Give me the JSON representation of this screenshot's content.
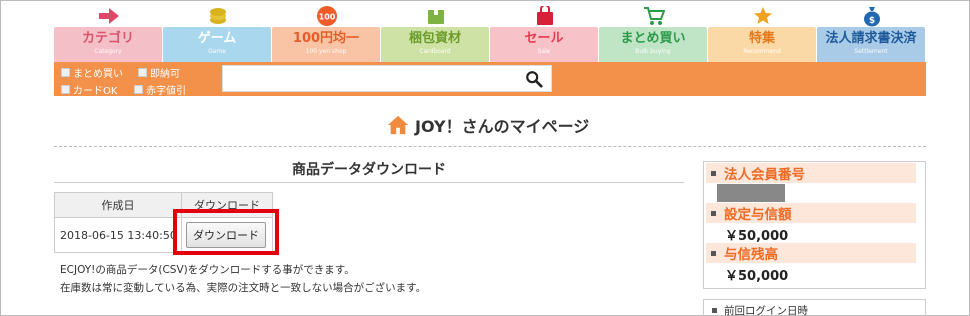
{
  "nav": {
    "items": [
      {
        "label": "カテゴリ",
        "sub": "Category",
        "bg": "#f4bfc6",
        "fg": "#d9546b",
        "icon": "arrow-right-icon",
        "icon_color": "#e2476a"
      },
      {
        "label": "ゲーム",
        "sub": "Game",
        "bg": "#a9d8ee",
        "fg": "#ffffff",
        "icon": "coins-icon",
        "icon_color": "#d7b321"
      },
      {
        "label": "100円均一",
        "sub": "100 yen shop",
        "bg": "#f8c4a5",
        "fg": "#e65d29",
        "icon": "100-badge-icon",
        "icon_color": "#ef5c2a",
        "icon_text": "100"
      },
      {
        "label": "梱包資材",
        "sub": "Cardboard",
        "bg": "#cfe2a5",
        "fg": "#6c9d2b",
        "icon": "box-icon",
        "icon_color": "#7db343"
      },
      {
        "label": "セール",
        "sub": "Sale",
        "bg": "#f7c2c8",
        "fg": "#e33c4e",
        "icon": "sale-bag-icon",
        "icon_color": "#d81f3a"
      },
      {
        "label": "まとめ買い",
        "sub": "Bulk buying",
        "bg": "#bfe4c6",
        "fg": "#2d9a48",
        "icon": "cart-icon",
        "icon_color": "#2d9a48"
      },
      {
        "label": "特集",
        "sub": "Recommend",
        "bg": "#fbd9a6",
        "fg": "#e3791e",
        "icon": "star-icon",
        "icon_color": "#f2a21e"
      },
      {
        "label": "法人請求書決済",
        "sub": "Settlement",
        "bg": "#a9cbe8",
        "fg": "#1f5b9c",
        "icon": "money-bag-icon",
        "icon_color": "#2167b1"
      }
    ]
  },
  "filters": {
    "row1": [
      "まとめ買い",
      "即納可"
    ],
    "row2": [
      "カードOK",
      "赤字値引"
    ]
  },
  "search": {
    "placeholder": ""
  },
  "page": {
    "title": "JOY！さんのマイページ"
  },
  "section": {
    "title": "商品データダウンロード"
  },
  "table": {
    "headers": [
      "作成日",
      "ダウンロード"
    ],
    "rows": [
      {
        "date": "2018-06-15 13:40:50",
        "button": "ダウンロード"
      }
    ]
  },
  "notes": [
    "ECJOY!の商品データ(CSV)をダウンロードする事ができます。",
    "在庫数は常に変動している為、実際の注文時と一致しない場合がございます。"
  ],
  "sidebar": {
    "member_no_label": "法人会員番号",
    "credit_limit_label": "設定与信額",
    "credit_limit_value": "￥50,000",
    "credit_remaining_label": "与信残高",
    "credit_remaining_value": "￥50,000",
    "last_login_label": "前回ログイン日時"
  },
  "colors": {
    "accent": "#f3914a",
    "highlight": "#e0000f",
    "side_title": "#ef6a22"
  }
}
